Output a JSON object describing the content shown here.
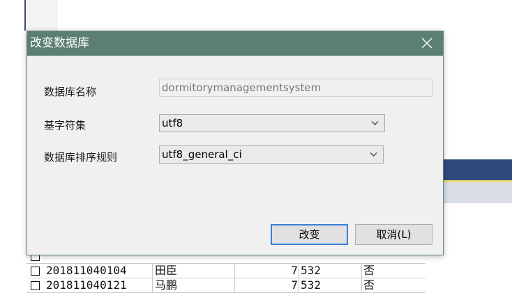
{
  "dialog": {
    "title": "改变数据库",
    "close_icon": "close-icon"
  },
  "form": {
    "db_name_label": "数据库名称",
    "db_name_value": "dormitorymanagementsystem",
    "charset_label": "基字符集",
    "charset_value": "utf8",
    "collation_label": "数据库排序规则",
    "collation_value": "utf8_general_ci"
  },
  "buttons": {
    "ok_label": "改变",
    "cancel_label": "取消(L)"
  },
  "background_table": {
    "rows": [
      {
        "id": "",
        "name": "",
        "num": "",
        "room": "",
        "flag": ""
      },
      {
        "id": "201811040104",
        "name": "田臣",
        "num": "7",
        "room": "532",
        "flag": "否"
      },
      {
        "id": "201811040121",
        "name": "马鹏",
        "num": "7",
        "room": "532",
        "flag": "否"
      }
    ]
  },
  "colors": {
    "titlebar": "#5b7f71",
    "accent_button_border": "#3c7fd9"
  }
}
